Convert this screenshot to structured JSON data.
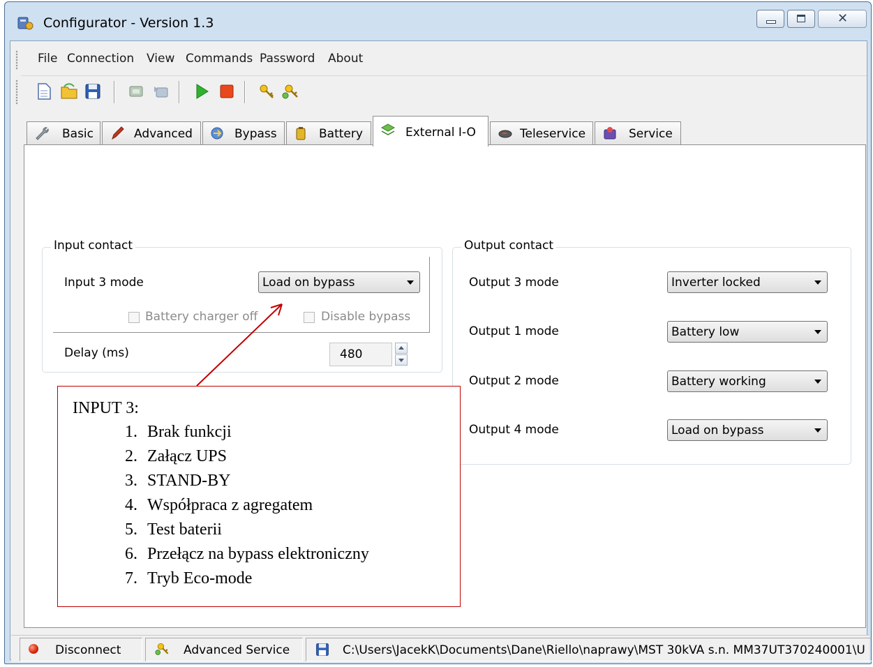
{
  "window": {
    "title": "Configurator - Version 1.3",
    "accent": "#cfe0f1",
    "icons": [
      "app-icon",
      "minimize-icon",
      "maximize-icon",
      "close-icon"
    ]
  },
  "menubar": {
    "items": [
      "File",
      "Connection",
      "View",
      "Commands",
      "Password",
      "About"
    ]
  },
  "toolbar": {
    "buttons": [
      "new-file-icon",
      "open-folder-icon",
      "save-icon",
      "read-device-icon",
      "write-device-icon",
      "start-icon",
      "stop-icon",
      "key-icon",
      "advanced-key-icon"
    ]
  },
  "tabs": [
    {
      "label": "Basic",
      "icon": "wrench-icon"
    },
    {
      "label": "Advanced",
      "icon": "pen-icon"
    },
    {
      "label": "Bypass",
      "icon": "bypass-icon"
    },
    {
      "label": "Battery",
      "icon": "battery-icon"
    },
    {
      "label": "External I-O",
      "icon": "external-io-icon",
      "active": true
    },
    {
      "label": "Teleservice",
      "icon": "modem-icon"
    },
    {
      "label": "Service",
      "icon": "service-icon"
    }
  ],
  "input_contact": {
    "title": "Input contact",
    "mode_label": "Input 3 mode",
    "mode_value": "Load on bypass",
    "checkbox1": "Battery charger off",
    "checkbox2": "Disable bypass",
    "delay_label": "Delay (ms)",
    "delay_value": "480"
  },
  "output_contact": {
    "title": "Output contact",
    "rows": [
      {
        "label": "Output 3 mode",
        "value": "Inverter locked"
      },
      {
        "label": "Output 1 mode",
        "value": "Battery low"
      },
      {
        "label": "Output 2 mode",
        "value": "Battery working"
      },
      {
        "label": "Output 4 mode",
        "value": "Load on bypass"
      }
    ]
  },
  "callout": {
    "title": "INPUT 3:",
    "items": [
      "Brak funkcji",
      "Załącz UPS",
      "STAND-BY",
      "Współpraca z agregatem",
      "Test baterii",
      "Przełącz na bypass elektroniczny",
      "Tryb Eco-mode"
    ],
    "numbers": [
      "1.",
      "2.",
      "3.",
      "4.",
      "5.",
      "6.",
      "7."
    ],
    "border_color": "#c00000"
  },
  "statusbar": {
    "connection": "Disconnect",
    "mode": "Advanced Service",
    "path": "C:\\Users\\JacekK\\Documents\\Dane\\Riello\\naprawy\\MST 30kVA s.n. MM37UT370240001\\U"
  }
}
